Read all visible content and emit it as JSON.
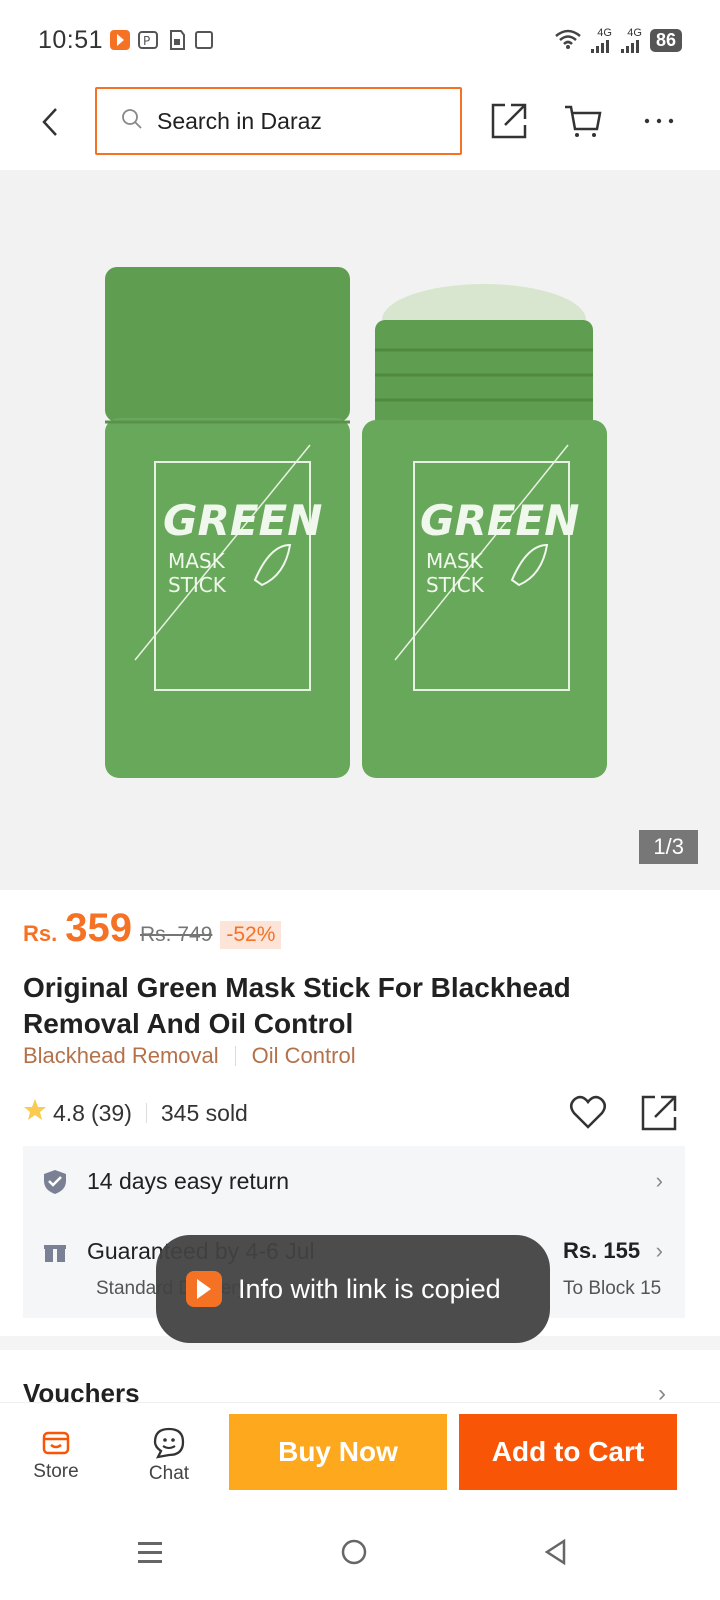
{
  "status_bar": {
    "time": "10:51",
    "network_1": "4G",
    "network_2": "4G",
    "battery": "86"
  },
  "search": {
    "placeholder": "Search in Daraz"
  },
  "gallery": {
    "label_line1": "GREEN",
    "label_line2": "MASK",
    "label_line3": "STICK",
    "counter": "1/3",
    "product_color": "#6aa65a"
  },
  "product": {
    "currency": "Rs.",
    "price": "359",
    "old_price": "Rs. 749",
    "discount": "-52%",
    "title": "Original Green Mask Stick For Blackhead Removal And Oil Control",
    "tags": [
      "Blackhead Removal",
      "Oil Control"
    ],
    "rating": "4.8",
    "reviews": "(39)",
    "sold": "345 sold"
  },
  "services": {
    "return_text": "14 days easy return",
    "delivery_text": "Guaranteed by 4-6 Jul",
    "delivery_sub": "Standard Delivery",
    "delivery_price": "Rs. 155",
    "delivery_location": "To Block 15"
  },
  "vouchers": {
    "title": "Vouchers"
  },
  "toast": {
    "message": "Info with link is copied"
  },
  "bottom_bar": {
    "store_label": "Store",
    "chat_label": "Chat",
    "buy_now": "Buy Now",
    "add_to_cart": "Add to Cart"
  },
  "colors": {
    "accent": "#f57224",
    "buy_now": "#fea81e",
    "add_to_cart": "#f85606",
    "tag_text": "#b4714a"
  }
}
